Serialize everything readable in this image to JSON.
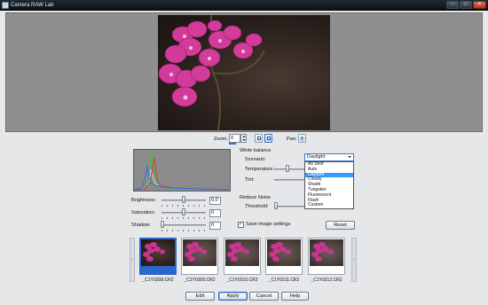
{
  "window": {
    "title": "Camera RAW Lab",
    "minimize_label": "–",
    "maximize_label": "□",
    "close_label": "✕"
  },
  "preview": {
    "zoom_label": "Zoom:",
    "zoom_value": "0",
    "pan_label": "Pan:"
  },
  "histogram": {
    "colors": {
      "red": "#e0323a",
      "green": "#32c83c",
      "blue": "#2f6fe6",
      "luminance": "#e8e8e8"
    }
  },
  "adjust": {
    "brightness": {
      "label": "Brightness:",
      "value": "0.0"
    },
    "saturation": {
      "label": "Saturation:",
      "value": "0"
    },
    "shadow": {
      "label": "Shadow:",
      "value": "0"
    }
  },
  "white_balance": {
    "heading": "White balance",
    "scenario_label": "Scenario:",
    "scenario_value": "Daylight",
    "temperature_label": "Temperature:",
    "tint_label": "Tint:",
    "options": [
      "As Shot",
      "Auto",
      "Daylight",
      "Cloudy",
      "Shade",
      "Tungsten",
      "Fluorescent",
      "Flash",
      "Custom"
    ],
    "highlighted_index": 2
  },
  "noise": {
    "heading": "Reduce Noise",
    "threshold_label": "Threshold:"
  },
  "save_settings": {
    "label": "Save image settings",
    "checked": "✓"
  },
  "reset_label": "Reset",
  "filmstrip": {
    "prev_label": "‹",
    "next_label": "›",
    "items": [
      {
        "label": "_C1Y0208.CR2"
      },
      {
        "label": "_C1Y0209.CR2"
      },
      {
        "label": "_C1Y0210.CR2"
      },
      {
        "label": "_C1Y0211.CR2"
      },
      {
        "label": "_C1Y0212.CR2"
      }
    ]
  },
  "footer": {
    "edit": "Edit",
    "apply": "Apply",
    "cancel": "Cancel",
    "help": "Help"
  }
}
